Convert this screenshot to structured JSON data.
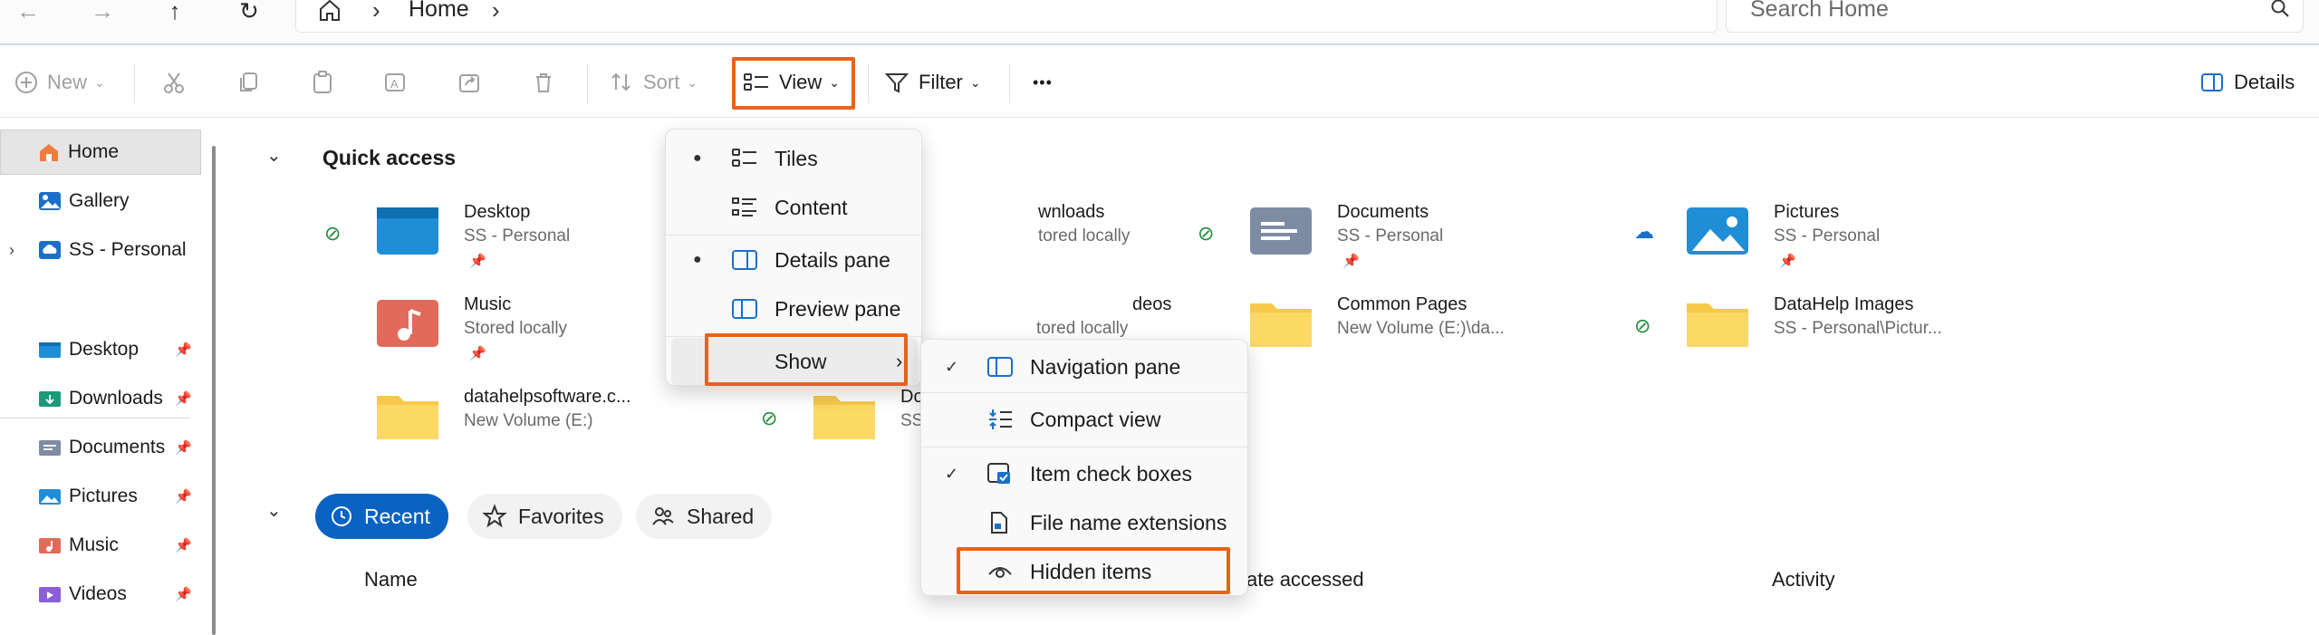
{
  "address_bar": {
    "breadcrumb": [
      "Home"
    ],
    "search_placeholder": "Search Home"
  },
  "toolbar": {
    "new": "New",
    "sort": "Sort",
    "view": "View",
    "filter": "Filter",
    "more": "•••",
    "details": "Details"
  },
  "sidebar": {
    "items": [
      {
        "label": "Home",
        "icon": "home-icon",
        "selected": true
      },
      {
        "label": "Gallery",
        "icon": "gallery-icon"
      },
      {
        "label": "SS - Personal",
        "icon": "cloud-icon",
        "expandable": true
      }
    ],
    "pinned": [
      {
        "label": "Desktop",
        "icon": "desktop-folder-icon"
      },
      {
        "label": "Downloads",
        "icon": "downloads-folder-icon"
      },
      {
        "label": "Documents",
        "icon": "documents-folder-icon"
      },
      {
        "label": "Pictures",
        "icon": "pictures-folder-icon"
      },
      {
        "label": "Music",
        "icon": "music-folder-icon"
      },
      {
        "label": "Videos",
        "icon": "videos-folder-icon"
      }
    ]
  },
  "quick_access": {
    "title": "Quick access",
    "items": [
      {
        "name": "Desktop",
        "sub": "SS - Personal",
        "status": "synced",
        "pinned": true
      },
      {
        "name": "wnloads",
        "sub": "tored locally",
        "pinned": true
      },
      {
        "name": "Documents",
        "sub": "SS - Personal",
        "status": "synced",
        "pinned": true
      },
      {
        "name": "Pictures",
        "sub": "SS - Personal",
        "status": "cloud",
        "pinned": true
      },
      {
        "name": "Music",
        "sub": "Stored locally",
        "pinned": true
      },
      {
        "name": "deos",
        "sub": "tored locally",
        "pinned": true
      },
      {
        "name": "Common Pages",
        "sub": "New Volume (E:)\\da..."
      },
      {
        "name": "DataHelp Images",
        "sub": "SS - Personal\\Pictur...",
        "status": "synced"
      },
      {
        "name": "datahelpsoftware.c...",
        "sub": "New Volume (E:)"
      },
      {
        "name": "Do",
        "sub": "SS",
        "status": "synced"
      }
    ]
  },
  "recent": {
    "tabs": [
      "Recent",
      "Favorites",
      "Shared"
    ],
    "active_tab": "Recent",
    "columns": [
      "Name",
      "ate accessed",
      "Activity"
    ]
  },
  "view_menu": {
    "items": [
      {
        "label": "Tiles",
        "selected": true
      },
      {
        "label": "Content"
      },
      {
        "label": "Details pane",
        "selected": true
      },
      {
        "label": "Preview pane"
      },
      {
        "label": "Show",
        "submenu": true
      }
    ]
  },
  "show_submenu": {
    "items": [
      {
        "label": "Navigation pane",
        "checked": true
      },
      {
        "label": "Compact view"
      },
      {
        "label": "Item check boxes",
        "checked": true
      },
      {
        "label": "File name extensions"
      },
      {
        "label": "Hidden items"
      }
    ]
  },
  "colors": {
    "accent": "#0a62c3",
    "highlight": "#e8621c",
    "sync_green": "#1e8a3a"
  }
}
